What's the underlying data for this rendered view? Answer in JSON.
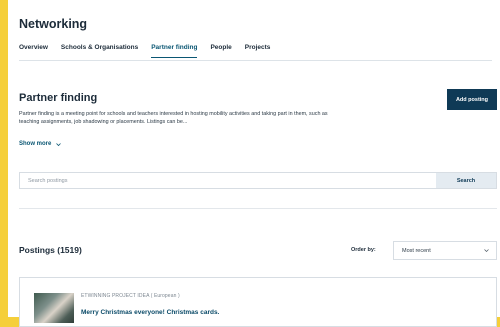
{
  "app": {
    "title": "Networking"
  },
  "tabs": [
    {
      "label": "Overview"
    },
    {
      "label": "Schools & Organisations"
    },
    {
      "label": "Partner finding"
    },
    {
      "label": "People"
    },
    {
      "label": "Projects"
    }
  ],
  "active_tab": "Partner finding",
  "section": {
    "title": "Partner finding",
    "add_button": "Add posting",
    "description": "Partner finding is a meeting point for schools and teachers interested in hosting mobility activities and taking part in them, such as teaching assignments, job shadowing or placements. Listings can be...",
    "show_more": "Show more"
  },
  "search": {
    "placeholder": "Search postings",
    "button": "Search"
  },
  "postings": {
    "title": "Postings (1519)",
    "order_label": "Order by:",
    "order_value": "Most recent"
  },
  "card": {
    "kicker": "ETWINNING PROJECT IDEA ( European )",
    "title": "Merry Christmas everyone! Christmas cards."
  },
  "colors": {
    "frame": "#f5cf3a",
    "primary": "#0f3a56",
    "link": "#0a5673"
  }
}
